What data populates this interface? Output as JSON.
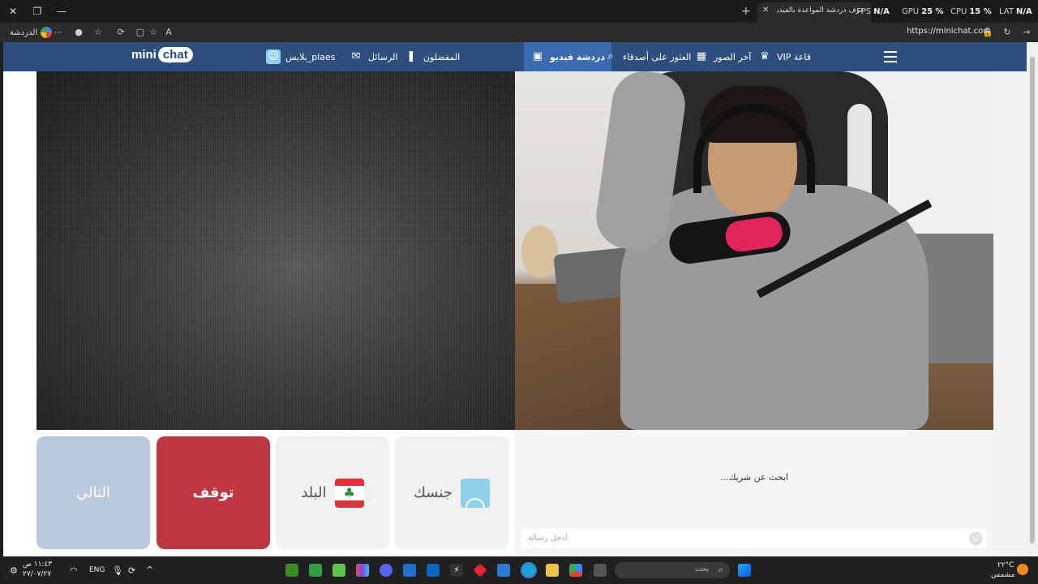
{
  "browser": {
    "tab_title": "عرف دردشة المواعدة بالفيديو",
    "url": "https://minichat.com",
    "profile_label": "الدردشة",
    "hud": {
      "fps_label": "FPS",
      "fps_value": "N/A",
      "gpu_label": "GPU",
      "gpu_value": "25 %",
      "cpu_label": "CPU",
      "cpu_value": "15 %",
      "lat_label": "LAT",
      "lat_value": "N/A"
    }
  },
  "site": {
    "brand_mini": "mini",
    "brand_chat": "chat",
    "nav": {
      "vip": "VIP قاعة",
      "latest_photos": "آخر الصور",
      "find_friends": "العثور على أصدقاء",
      "video_chat": "دردشة فيديو",
      "favorites": "المفضلون",
      "messages": "الرسائل",
      "profile": "بلايس_plaes"
    }
  },
  "controls": {
    "next_label": "التالي",
    "stop_label": "توقف",
    "country_label": "البلد",
    "gender_label": "جنسك",
    "country_flag": "lebanon-flag"
  },
  "chat": {
    "status_text": "...ابحث عن شريك",
    "input_placeholder": "ادخل رسالة"
  },
  "taskbar": {
    "time": "١١:٤٣ ص",
    "date": "٢٧/٠٧/٢٧",
    "lang": "ENG",
    "search_placeholder": "بحث",
    "weather_temp": "٢٢°C",
    "weather_desc": "مشمس"
  },
  "colors": {
    "nav_bg": "#2e4f7e",
    "nav_active": "#3a6bb0",
    "next_tile": "#b9c8dc",
    "stop_tile": "#c03642"
  }
}
